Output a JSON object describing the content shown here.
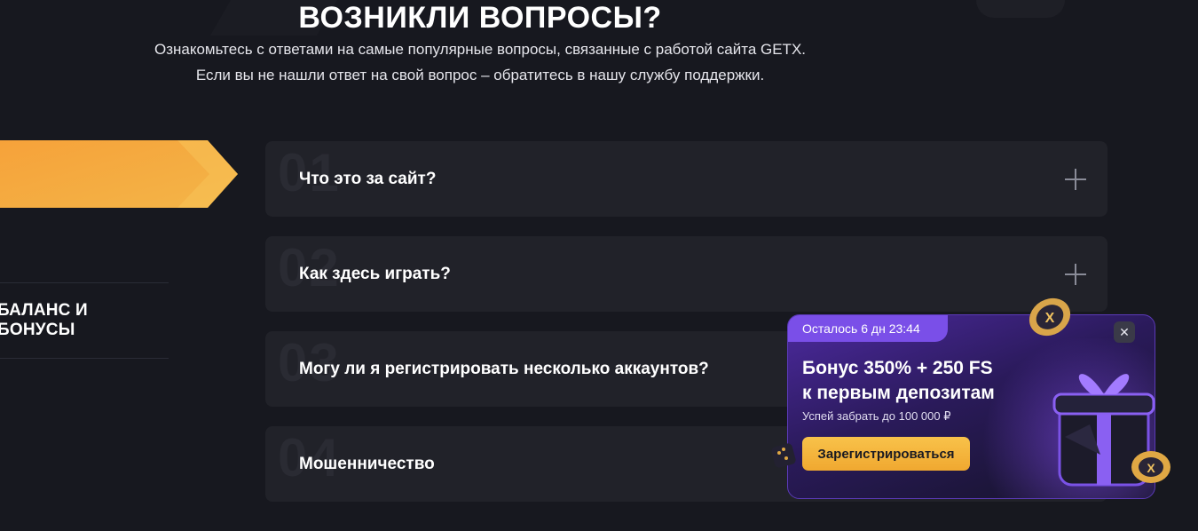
{
  "header": {
    "title": "ВОЗНИКЛИ ВОПРОСЫ?",
    "subtitle_line1": "Ознакомьтесь с ответами на самые популярные вопросы, связанные с работой сайта GETX.",
    "subtitle_line2": "Если вы не нашли ответ на свой вопрос – обратитесь в нашу службу поддержки."
  },
  "nav": {
    "items": [
      {
        "label": "БАЛАНС И БОНУСЫ"
      }
    ]
  },
  "faq": {
    "items": [
      {
        "num": "01",
        "question": "Что это за сайт?"
      },
      {
        "num": "02",
        "question": "Как здесь играть?"
      },
      {
        "num": "03",
        "question": "Могу ли я регистрировать несколько аккаунтов?"
      },
      {
        "num": "04",
        "question": "Мошенничество"
      }
    ]
  },
  "promo": {
    "timer": "Осталось 6 дн 23:44",
    "title_line1": "Бонус 350% + 250 FS",
    "title_line2": "к первым депозитам",
    "note": "Успей забрать до 100 000 ₽",
    "button": "Зарегистрироваться",
    "close": "✕"
  },
  "colors": {
    "background": "#17181f",
    "card": "#212229",
    "accent_orange": "#f0a830",
    "accent_purple": "#7a4fe8"
  }
}
